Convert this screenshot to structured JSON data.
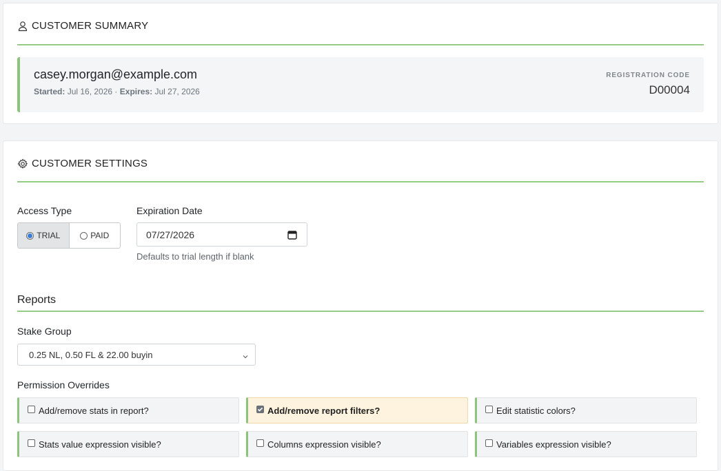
{
  "summary": {
    "title": "CUSTOMER SUMMARY",
    "email": "casey.morgan@example.com",
    "started_label": "Started:",
    "started_value": "Jul 16, 2026",
    "separator": "·",
    "expires_label": "Expires:",
    "expires_value": "Jul 27, 2026",
    "reg_label": "REGISTRATION CODE",
    "reg_code": "D00004"
  },
  "settings": {
    "title": "CUSTOMER SETTINGS",
    "access_type_label": "Access Type",
    "access_options": [
      "TRIAL",
      "PAID"
    ],
    "access_selected": "TRIAL",
    "expiration_label": "Expiration Date",
    "expiration_value": "07/27/2026",
    "expiration_help": "Defaults to trial length if blank"
  },
  "reports": {
    "title": "Reports",
    "stake_group_label": "Stake Group",
    "stake_group_value": "0.25 NL, 0.50 FL & 22.00 buyin",
    "overrides_label": "Permission Overrides",
    "permissions": [
      {
        "label": "Add/remove stats in report?",
        "checked": false
      },
      {
        "label": "Add/remove report filters?",
        "checked": true
      },
      {
        "label": "Edit statistic colors?",
        "checked": false
      },
      {
        "label": "Stats value expression visible?",
        "checked": false
      },
      {
        "label": "Columns expression visible?",
        "checked": false
      },
      {
        "label": "Variables expression visible?",
        "checked": false
      }
    ]
  },
  "colors": {
    "accent_green": "#8bc47a",
    "highlight": "#fdf3df",
    "radio_blue": "#3b7bd6"
  }
}
